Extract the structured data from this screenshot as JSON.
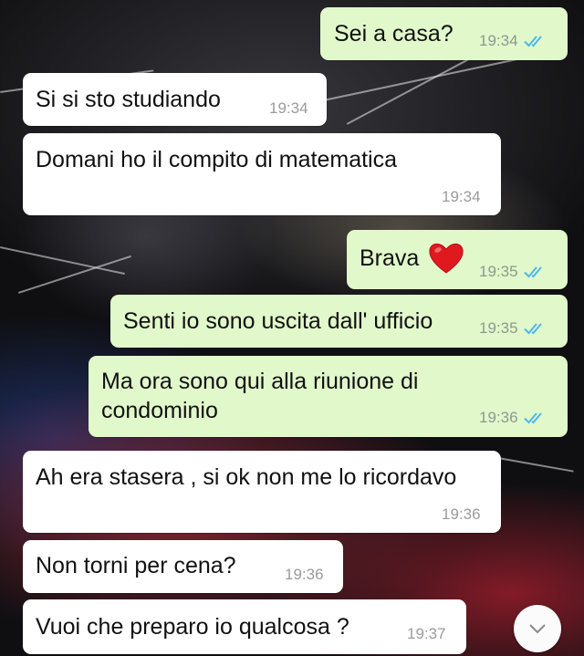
{
  "chat": {
    "messages": [
      {
        "direction": "out",
        "text": "Sei a casa?",
        "time": "19:34",
        "read": true
      },
      {
        "direction": "in",
        "text": "Si si sto studiando",
        "time": "19:34"
      },
      {
        "direction": "in",
        "text": "Domani ho il compito di matematica",
        "time": "19:34"
      },
      {
        "direction": "out",
        "text": "Brava",
        "emoji": "heart-emoji",
        "time": "19:35",
        "read": true
      },
      {
        "direction": "out",
        "text": "Senti io sono uscita dall' ufficio",
        "time": "19:35",
        "read": true
      },
      {
        "direction": "out",
        "text_line1": "Ma ora sono qui alla riunione di",
        "text_line2": "condominio",
        "time": "19:36",
        "read": true
      },
      {
        "direction": "in",
        "text": "Ah era stasera , si ok non me lo ricordavo",
        "time": "19:36"
      },
      {
        "direction": "in",
        "text": "Non torni per cena?",
        "time": "19:36"
      },
      {
        "direction": "in",
        "text": "Vuoi che preparo io qualcosa ?",
        "time": "19:37"
      }
    ]
  },
  "colors": {
    "incoming_bubble": "#ffffff",
    "outgoing_bubble": "#e1f8cb",
    "read_ticks": "#4fb6ec"
  },
  "icons": {
    "read_receipt": "double-check-icon",
    "scroll_down": "chevron-down-icon"
  }
}
